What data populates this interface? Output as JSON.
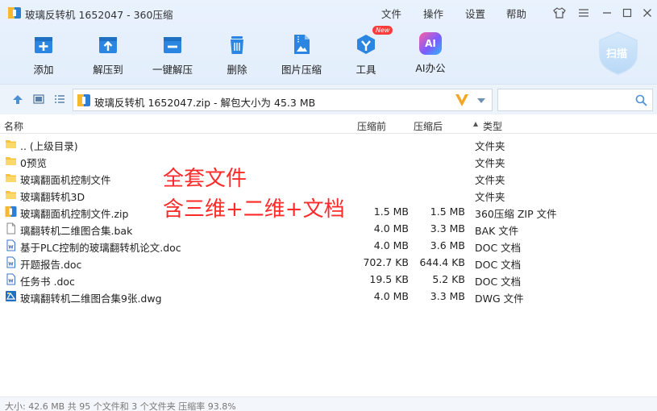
{
  "window": {
    "title": "玻璃反转机 1652047 - 360压缩",
    "menu": [
      "文件",
      "操作",
      "设置",
      "帮助"
    ]
  },
  "toolbar": {
    "items": [
      {
        "label": "添加",
        "icon": "add-icon"
      },
      {
        "label": "解压到",
        "icon": "extract-to-icon"
      },
      {
        "label": "一键解压",
        "icon": "one-click-extract-icon"
      },
      {
        "label": "删除",
        "icon": "delete-icon"
      },
      {
        "label": "图片压缩",
        "icon": "image-compress-icon"
      },
      {
        "label": "工具",
        "icon": "tools-icon",
        "badge": "New"
      },
      {
        "label": "AI办公",
        "icon": "ai-office-icon",
        "icon_text": "AI"
      }
    ],
    "scan_label": "扫描"
  },
  "address": {
    "path": "玻璃反转机 1652047.zip - 解包大小为 45.3 MB",
    "search_placeholder": ""
  },
  "columns": {
    "name": "名称",
    "size": "压缩前",
    "packed": "压缩后",
    "type": "类型"
  },
  "files": [
    {
      "name": ".. (上级目录)",
      "size": "",
      "packed": "",
      "type": "文件夹",
      "icon": "folder-up-icon"
    },
    {
      "name": "0预览",
      "size": "",
      "packed": "",
      "type": "文件夹",
      "icon": "folder-icon"
    },
    {
      "name": "玻璃翻面机控制文件",
      "size": "",
      "packed": "",
      "type": "文件夹",
      "icon": "folder-icon"
    },
    {
      "name": "玻璃翻转机3D",
      "size": "",
      "packed": "",
      "type": "文件夹",
      "icon": "folder-icon"
    },
    {
      "name": "玻璃翻面机控制文件.zip",
      "size": "1.5 MB",
      "packed": "1.5 MB",
      "type": "360压缩 ZIP 文件",
      "icon": "zip-file-icon"
    },
    {
      "name": "璃翻转机二维图合集.bak",
      "size": "4.0 MB",
      "packed": "3.3 MB",
      "type": "BAK 文件",
      "icon": "file-icon"
    },
    {
      "name": "基于PLC控制的玻璃翻转机论文.doc",
      "size": "4.0 MB",
      "packed": "3.6 MB",
      "type": "DOC 文档",
      "icon": "doc-file-icon"
    },
    {
      "name": "开题报告.doc",
      "size": "702.7 KB",
      "packed": "644.4 KB",
      "type": "DOC 文档",
      "icon": "doc-file-icon"
    },
    {
      "name": "任务书 .doc",
      "size": "19.5 KB",
      "packed": "5.2 KB",
      "type": "DOC 文档",
      "icon": "doc-file-icon"
    },
    {
      "name": "玻璃翻转机二维图合集9张.dwg",
      "size": "4.0 MB",
      "packed": "3.3 MB",
      "type": "DWG 文件",
      "icon": "dwg-file-icon"
    }
  ],
  "overlay_text": {
    "line1": "全套文件",
    "line2": "含三维+二维+文档"
  },
  "status": "大小: 42.6 MB 共 95 个文件和 3 个文件夹 压缩率 93.8%",
  "colors": {
    "accent": "#1e88e5",
    "overlay_red": "#ff2a2a",
    "folder_yellow": "#f7c33c",
    "header_bg": "#e6f0fc"
  }
}
